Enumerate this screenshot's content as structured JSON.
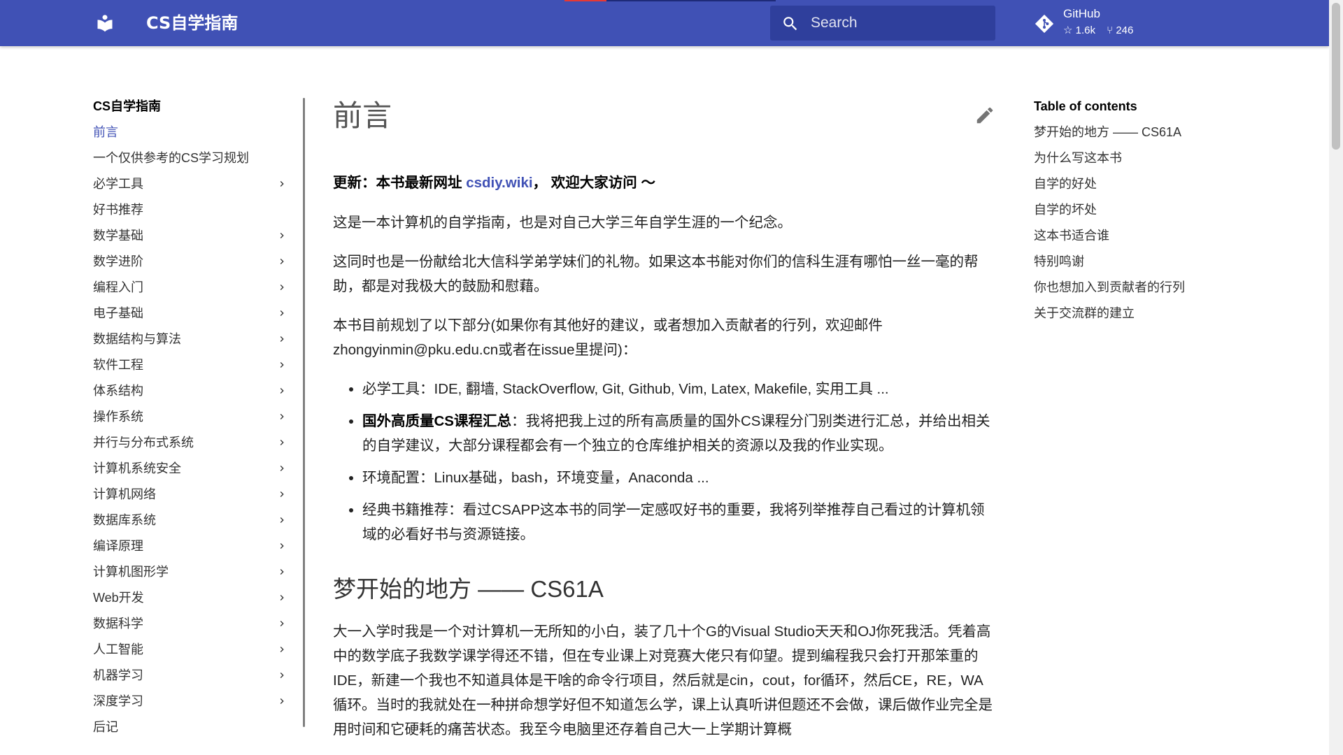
{
  "header": {
    "site_title": "CS自学指南",
    "search_placeholder": "Search",
    "repo": {
      "name": "GitHub",
      "stars": "1.6k",
      "forks": "246"
    }
  },
  "sidebar": {
    "title": "CS自学指南",
    "items": [
      {
        "label": "前言",
        "active": true,
        "expandable": false
      },
      {
        "label": "一个仅供参考的CS学习规划",
        "active": false,
        "expandable": false
      },
      {
        "label": "必学工具",
        "active": false,
        "expandable": true
      },
      {
        "label": "好书推荐",
        "active": false,
        "expandable": false
      },
      {
        "label": "数学基础",
        "active": false,
        "expandable": true
      },
      {
        "label": "数学进阶",
        "active": false,
        "expandable": true
      },
      {
        "label": "编程入门",
        "active": false,
        "expandable": true
      },
      {
        "label": "电子基础",
        "active": false,
        "expandable": true
      },
      {
        "label": "数据结构与算法",
        "active": false,
        "expandable": true
      },
      {
        "label": "软件工程",
        "active": false,
        "expandable": true
      },
      {
        "label": "体系结构",
        "active": false,
        "expandable": true
      },
      {
        "label": "操作系统",
        "active": false,
        "expandable": true
      },
      {
        "label": "并行与分布式系统",
        "active": false,
        "expandable": true
      },
      {
        "label": "计算机系统安全",
        "active": false,
        "expandable": true
      },
      {
        "label": "计算机网络",
        "active": false,
        "expandable": true
      },
      {
        "label": "数据库系统",
        "active": false,
        "expandable": true
      },
      {
        "label": "编译原理",
        "active": false,
        "expandable": true
      },
      {
        "label": "计算机图形学",
        "active": false,
        "expandable": true
      },
      {
        "label": "Web开发",
        "active": false,
        "expandable": true
      },
      {
        "label": "数据科学",
        "active": false,
        "expandable": true
      },
      {
        "label": "人工智能",
        "active": false,
        "expandable": true
      },
      {
        "label": "机器学习",
        "active": false,
        "expandable": true
      },
      {
        "label": "深度学习",
        "active": false,
        "expandable": true
      },
      {
        "label": "后记",
        "active": false,
        "expandable": false
      }
    ]
  },
  "main": {
    "title": "前言",
    "update": {
      "prefix": "更新：本书最新网址 ",
      "link": "csdiy.wiki",
      "suffix": "， 欢迎大家访问 ～"
    },
    "paragraphs": [
      "这是一本计算机的自学指南，也是对自己大学三年自学生涯的一个纪念。",
      "这同时也是一份献给北大信科学弟学妹们的礼物。如果这本书能对你们的信科生涯有哪怕一丝一毫的帮助，都是对我极大的鼓励和慰藉。",
      "本书目前规划了以下部分(如果你有其他好的建议，或者想加入贡献者的行列，欢迎邮件zhongyinmin@pku.edu.cn或者在issue里提问)："
    ],
    "list": [
      {
        "bold": "",
        "text": "必学工具：IDE, 翻墙, StackOverflow, Git, Github, Vim, Latex, Makefile, 实用工具 ..."
      },
      {
        "bold": "国外高质量CS课程汇总",
        "text": "：我将把我上过的所有高质量的国外CS课程分门别类进行汇总，并给出相关的自学建议，大部分课程都会有一个独立的仓库维护相关的资源以及我的作业实现。"
      },
      {
        "bold": "",
        "text": "环境配置：Linux基础，bash，环境变量，Anaconda ..."
      },
      {
        "bold": "",
        "text": "经典书籍推荐：看过CSAPP这本书的同学一定感叹好书的重要，我将列举推荐自己看过的计算机领域的必看好书与资源链接。"
      }
    ],
    "section_heading": "梦开始的地方 —— CS61A",
    "section_paragraph": "大一入学时我是一个对计算机一无所知的小白，装了几十个G的Visual Studio天天和OJ你死我活。凭着高中的数学底子我数学课学得还不错，但在专业课上对竞赛大佬只有仰望。提到编程我只会打开那笨重的IDE，新建一个我也不知道具体是干啥的命令行项目，然后就是cin，cout，for循环，然后CE，RE，WA循环。当时的我就处在一种拼命想学好但不知道怎么学，课上认真听讲但题还不会做，课后做作业完全是用时间和它硬耗的痛苦状态。我至今电脑里还存着自己大一上学期计算概"
  },
  "toc": {
    "title": "Table of contents",
    "items": [
      "梦开始的地方 —— CS61A",
      "为什么写这本书",
      "自学的好处",
      "自学的坏处",
      "这本书适合谁",
      "特别鸣谢",
      "你也想加入到贡献者的行列",
      "关于交流群的建立"
    ]
  },
  "colors": {
    "primary": "#4051b5",
    "search_bg": "#2f3f9c",
    "link": "#4051b5"
  }
}
